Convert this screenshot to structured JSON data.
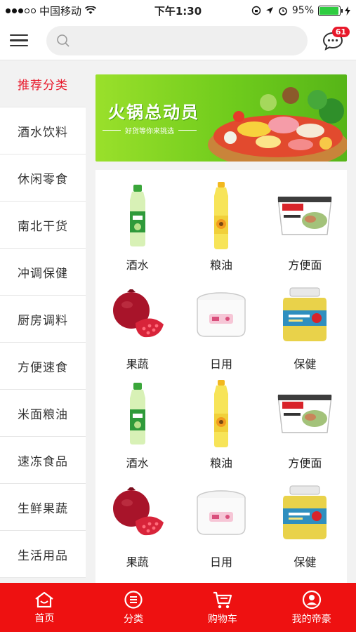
{
  "status": {
    "carrier": "中国移动",
    "time": "下午1:30",
    "battery": "95%",
    "battery_level": 0.95
  },
  "header": {
    "search_placeholder": "",
    "message_count": "61"
  },
  "sidebar": {
    "items": [
      {
        "label": "推荐分类",
        "active": true
      },
      {
        "label": "酒水饮料"
      },
      {
        "label": "休闲零食"
      },
      {
        "label": "南北干货"
      },
      {
        "label": "冲调保健"
      },
      {
        "label": "厨房调料"
      },
      {
        "label": "方便速食"
      },
      {
        "label": "米面粮油"
      },
      {
        "label": "速冻食品"
      },
      {
        "label": "生鲜果蔬"
      },
      {
        "label": "生活用品"
      }
    ]
  },
  "banner": {
    "title": "火锅总动员",
    "subtitle": "好货等你来挑选"
  },
  "products": [
    {
      "label": "酒水",
      "icon": "green-tea-bottle-icon"
    },
    {
      "label": "粮油",
      "icon": "oil-bottle-icon"
    },
    {
      "label": "方便面",
      "icon": "noodle-bowl-icon"
    },
    {
      "label": "果蔬",
      "icon": "pomegranate-icon"
    },
    {
      "label": "日用",
      "icon": "rice-cooker-icon"
    },
    {
      "label": "保健",
      "icon": "supplement-jar-icon"
    },
    {
      "label": "酒水",
      "icon": "green-tea-bottle-icon"
    },
    {
      "label": "粮油",
      "icon": "oil-bottle-icon"
    },
    {
      "label": "方便面",
      "icon": "noodle-bowl-icon"
    },
    {
      "label": "果蔬",
      "icon": "pomegranate-icon"
    },
    {
      "label": "日用",
      "icon": "rice-cooker-icon"
    },
    {
      "label": "保健",
      "icon": "supplement-jar-icon"
    }
  ],
  "tabbar": {
    "items": [
      {
        "label": "首页",
        "icon": "home-icon"
      },
      {
        "label": "分类",
        "icon": "category-icon"
      },
      {
        "label": "购物车",
        "icon": "cart-icon"
      },
      {
        "label": "我的帝豪",
        "icon": "profile-icon"
      }
    ]
  },
  "colors": {
    "accent": "#ee1111",
    "active_text": "#e8182a",
    "banner_green": "#7ad321"
  }
}
